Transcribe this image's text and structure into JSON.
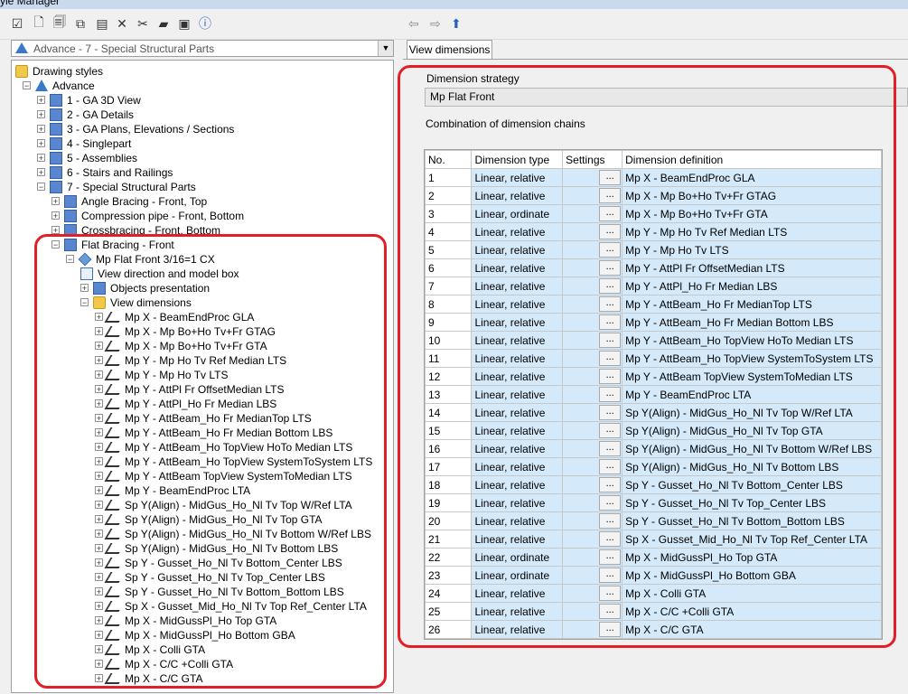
{
  "window": {
    "title": "yle Manager"
  },
  "toolbar": {
    "icons": [
      "check-icon",
      "new-icon",
      "new-copy-icon",
      "copy-icon",
      "paste-icon",
      "delete-icon",
      "cut-icon",
      "folder-icon",
      "export-icon",
      "help-icon"
    ]
  },
  "left_combo": {
    "value": "Advance - 7 - Special Structural Parts"
  },
  "tree": {
    "root": "Drawing styles",
    "advance": "Advance",
    "groups": [
      "1 - GA 3D View",
      "2 - GA Details",
      "3 - GA Plans, Elevations / Sections",
      "4 - Singlepart",
      "5 - Assemblies",
      "6 - Stairs and Railings",
      "7 - Special Structural Parts"
    ],
    "special_items": [
      "Angle Bracing - Front, Top",
      "Compression pipe - Front, Bottom",
      "Crossbracing - Front, Bottom",
      "Flat Bracing - Front"
    ],
    "flat_front": "Mp Flat Front 3/16=1 CX",
    "view_dir": "View direction and model box",
    "objects": "Objects presentation",
    "view_dims": "View dimensions",
    "dims": [
      "Mp X - BeamEndProc GLA",
      "Mp X - Mp Bo+Ho Tv+Fr GTAG",
      "Mp X - Mp Bo+Ho Tv+Fr GTA",
      "Mp Y - Mp Ho Tv  Ref Median LTS",
      "Mp Y - Mp Ho Tv LTS",
      "Mp Y - AttPl  Fr OffsetMedian LTS",
      "Mp Y - AttPl_Ho Fr Median LBS",
      "Mp Y - AttBeam_Ho Fr  MedianTop LTS",
      "Mp Y - AttBeam_Ho Fr Median Bottom LBS",
      "Mp Y - AttBeam_Ho TopView HoTo Median LTS",
      "Mp Y - AttBeam_Ho TopView SystemToSystem LTS",
      "Mp Y - AttBeam TopView SystemToMedian LTS",
      "Mp Y - BeamEndProc LTA",
      "Sp Y(Align) - MidGus_Ho_Nl Tv Top W/Ref LTA",
      "Sp Y(Align) - MidGus_Ho_Nl Tv Top GTA",
      "Sp Y(Align) - MidGus_Ho_Nl Tv Bottom W/Ref LBS",
      "Sp Y(Align) - MidGus_Ho_Nl Tv Bottom LBS",
      "Sp Y - Gusset_Ho_Nl Tv Bottom_Center LBS",
      "Sp Y - Gusset_Ho_Nl Tv Top_Center LBS",
      "Sp Y - Gusset_Ho_Nl Tv Bottom_Bottom LBS",
      "Sp X - Gusset_Mid_Ho_Nl Tv Top Ref_Center LTA",
      "Mp X - MidGussPl_Ho Top GTA",
      "Mp X - MidGussPl_Ho Bottom GBA",
      "Mp X - Colli GTA",
      "Mp X - C/C +Colli GTA",
      "Mp X - C/C GTA"
    ]
  },
  "right": {
    "tab": "View dimensions",
    "strategy_label": "Dimension strategy",
    "strategy_value": "Mp Flat Front",
    "chains_label": "Combination of dimension chains",
    "headers": [
      "No.",
      "Dimension type",
      "Settings",
      "Dimension definition"
    ],
    "settings_btn": "...",
    "rows": [
      [
        "1",
        "Linear, relative",
        "Mp X - BeamEndProc GLA"
      ],
      [
        "2",
        "Linear, relative",
        "Mp X - Mp Bo+Ho Tv+Fr GTAG"
      ],
      [
        "3",
        "Linear, ordinate",
        "Mp X - Mp Bo+Ho Tv+Fr GTA"
      ],
      [
        "4",
        "Linear, relative",
        "Mp Y - Mp Ho Tv  Ref Median LTS"
      ],
      [
        "5",
        "Linear, relative",
        "Mp Y - Mp Ho Tv LTS"
      ],
      [
        "6",
        "Linear, relative",
        "Mp Y - AttPl  Fr OffsetMedian LTS"
      ],
      [
        "7",
        "Linear, relative",
        "Mp Y - AttPl_Ho Fr Median LBS"
      ],
      [
        "8",
        "Linear, relative",
        "Mp Y - AttBeam_Ho Fr  MedianTop LTS"
      ],
      [
        "9",
        "Linear, relative",
        "Mp Y - AttBeam_Ho Fr Median Bottom LBS"
      ],
      [
        "10",
        "Linear, relative",
        "Mp Y - AttBeam_Ho TopView HoTo Median LTS"
      ],
      [
        "11",
        "Linear, relative",
        "Mp Y - AttBeam_Ho TopView SystemToSystem LTS"
      ],
      [
        "12",
        "Linear, relative",
        "Mp Y - AttBeam TopView SystemToMedian LTS"
      ],
      [
        "13",
        "Linear, relative",
        "Mp Y - BeamEndProc LTA"
      ],
      [
        "14",
        "Linear, relative",
        "Sp Y(Align) - MidGus_Ho_Nl Tv Top W/Ref LTA"
      ],
      [
        "15",
        "Linear, relative",
        "Sp Y(Align) - MidGus_Ho_Nl Tv Top GTA"
      ],
      [
        "16",
        "Linear, relative",
        "Sp Y(Align) - MidGus_Ho_Nl Tv Bottom W/Ref LBS"
      ],
      [
        "17",
        "Linear, relative",
        "Sp Y(Align) - MidGus_Ho_Nl Tv Bottom LBS"
      ],
      [
        "18",
        "Linear, relative",
        "Sp Y - Gusset_Ho_Nl Tv Bottom_Center LBS"
      ],
      [
        "19",
        "Linear, relative",
        "Sp Y - Gusset_Ho_Nl Tv Top_Center LBS"
      ],
      [
        "20",
        "Linear, relative",
        "Sp Y - Gusset_Ho_Nl Tv Bottom_Bottom LBS"
      ],
      [
        "21",
        "Linear, relative",
        "Sp X - Gusset_Mid_Ho_Nl Tv Top Ref_Center LTA"
      ],
      [
        "22",
        "Linear, ordinate",
        "Mp X - MidGussPl_Ho Top GTA"
      ],
      [
        "23",
        "Linear, ordinate",
        "Mp X - MidGussPl_Ho Bottom GBA"
      ],
      [
        "24",
        "Linear, relative",
        "Mp X - Colli GTA"
      ],
      [
        "25",
        "Linear, relative",
        "Mp X - C/C +Colli GTA"
      ],
      [
        "26",
        "Linear, relative",
        "Mp X - C/C GTA"
      ]
    ]
  },
  "colors": {
    "highlight": "#e21f26",
    "row_fill": "#d4e9f9"
  }
}
